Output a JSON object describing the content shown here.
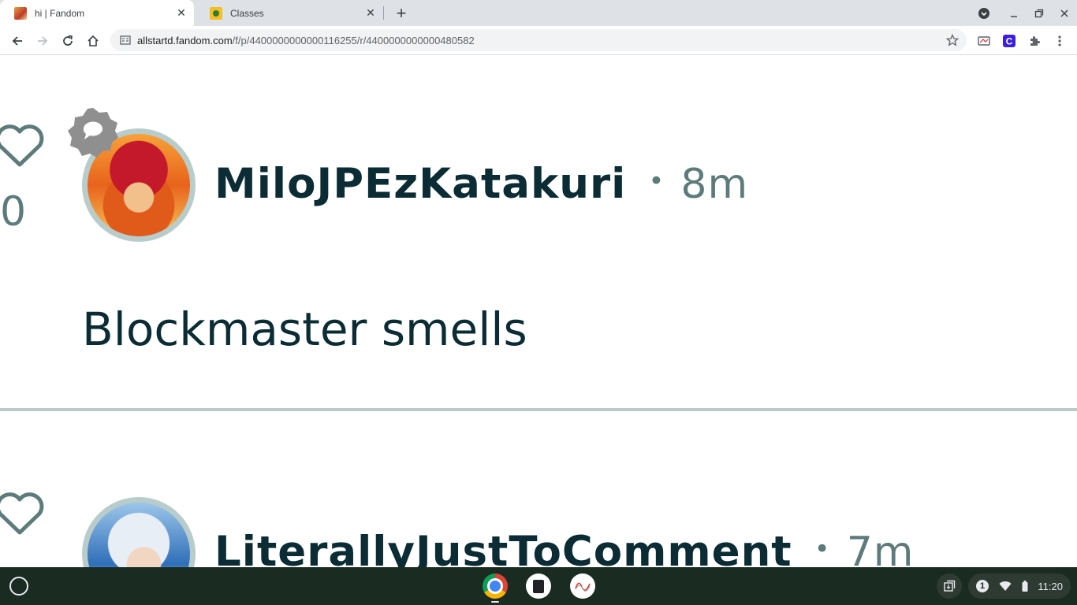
{
  "browser": {
    "tabs": [
      {
        "title": "hi | Fandom",
        "active": true
      },
      {
        "title": "Classes",
        "active": false
      }
    ],
    "new_tab_icon": "plus-icon",
    "url_domain": "allstartd.fandom.com",
    "url_path": "/f/p/4400000000000116255/r/4400000000000480582"
  },
  "replies": [
    {
      "username": "MiloJPEzKatakuri",
      "time": "8m",
      "likes": "0",
      "body": "Blockmaster smells"
    },
    {
      "username": "LiterallyJustToComment",
      "time": "7m",
      "likes": "",
      "body": ""
    }
  ],
  "bullet": "•",
  "shelf": {
    "notification_count": "1",
    "clock": "11:20"
  },
  "colors": {
    "text_dark": "#0b2c34",
    "text_muted": "#5d7b7b",
    "divider": "#b8cccb"
  }
}
